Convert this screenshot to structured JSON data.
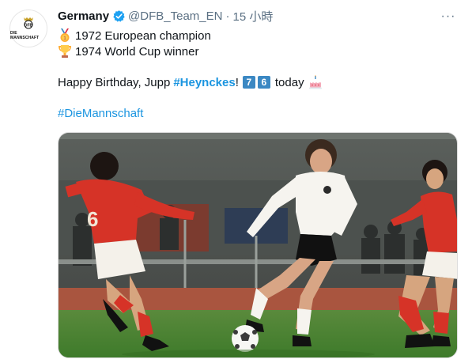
{
  "tweet": {
    "author_name": "Germany",
    "handle": "@DFB_Team_EN",
    "separator": "·",
    "time": "15 小時",
    "more_label": "···",
    "avatar_text": "DIE MANNSCHAFT",
    "line1": "1972 European champion",
    "line2": "1974 World Cup winner",
    "line3_prefix": "Happy Birthday, Jupp",
    "line3_hashtag": "#Heynckes",
    "line3_exclaim": "!",
    "age_digits": [
      "7",
      "6"
    ],
    "line3_suffix": "today",
    "hashtag2": "#DieMannschaft"
  },
  "icons": {
    "verified": "verified-badge-icon",
    "medal": "gold-medal-icon",
    "trophy": "trophy-icon",
    "cake": "birthday-cake-icon",
    "more": "more-options-icon",
    "crest": "dfb-crest-icon"
  },
  "colors": {
    "link": "#1b95e0",
    "muted": "#5b7083",
    "verified": "#1da1f2"
  }
}
